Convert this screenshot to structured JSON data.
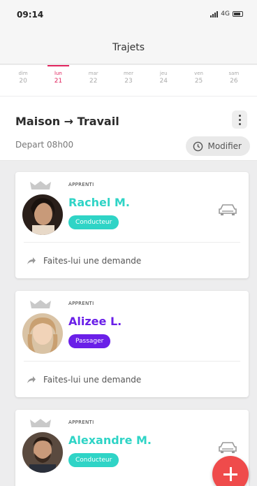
{
  "status_bar": {
    "time": "09:14",
    "network": "4G"
  },
  "header": {
    "title": "Trajets"
  },
  "days": [
    {
      "weekday": "dim",
      "date": "20",
      "active": false
    },
    {
      "weekday": "lun",
      "date": "21",
      "active": true
    },
    {
      "weekday": "mar",
      "date": "22",
      "active": false
    },
    {
      "weekday": "mer",
      "date": "23",
      "active": false
    },
    {
      "weekday": "jeu",
      "date": "24",
      "active": false
    },
    {
      "weekday": "ven",
      "date": "25",
      "active": false
    },
    {
      "weekday": "sam",
      "date": "26",
      "active": false
    }
  ],
  "route": {
    "title": "Maison → Travail",
    "departure": "Depart 08h00",
    "modify_label": "Modifier"
  },
  "cards": [
    {
      "badge": "APPRENTI",
      "name": "Rachel M.",
      "role": "Conducteur",
      "role_color": "#2fd4c6",
      "name_color": "#2fd4c6",
      "has_car": true,
      "action": "Faites-lui une demande"
    },
    {
      "badge": "APPRENTI",
      "name": "Alizee L.",
      "role": "Passager",
      "role_color": "#6a1fe8",
      "name_color": "#6a1fe8",
      "has_car": false,
      "action": "Faites-lui une demande"
    },
    {
      "badge": "APPRENTI",
      "name": "Alexandre M.",
      "role": "Conducteur",
      "role_color": "#2fd4c6",
      "name_color": "#2fd4c6",
      "has_car": true,
      "action": ""
    }
  ],
  "colors": {
    "accent_red": "#e0245e",
    "fab": "#ef4b4b"
  },
  "fab": {
    "icon": "plus-icon"
  }
}
